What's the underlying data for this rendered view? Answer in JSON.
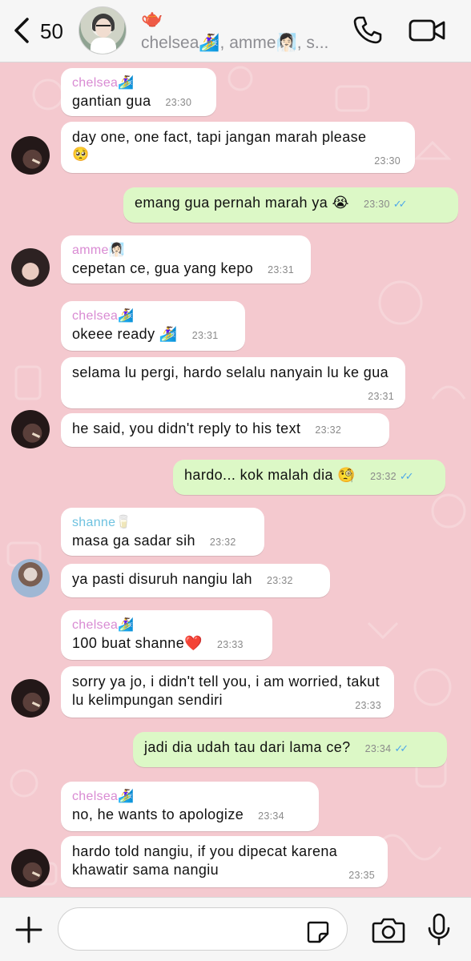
{
  "header": {
    "back_count": "50",
    "group_emoji": "🫖",
    "members": "chelsea🏄‍♀️, amme🧖🏻‍♀️, s...",
    "icons": {
      "back": "chevron-left-icon",
      "call": "phone-icon",
      "video": "video-camera-icon"
    }
  },
  "messages": [
    {
      "sender": "chelsea🏄‍♀️",
      "text": "gantian gua",
      "time": "23:30"
    },
    {
      "text": "day one, one fact, tapi jangan marah please",
      "emoji": "🥺",
      "time": "23:30"
    },
    {
      "text": "emang gua pernah marah ya 😭",
      "time": "23:30",
      "direction": "outgoing"
    },
    {
      "sender": "amme🧖🏻‍♀️",
      "text": "cepetan ce, gua yang kepo",
      "time": "23:31"
    },
    {
      "sender": "chelsea🏄‍♀️",
      "text": "okeee ready 🏄‍♀️",
      "time": "23:31"
    },
    {
      "text": "selama lu pergi, hardo selalu nanyain lu ke gua",
      "time": "23:31"
    },
    {
      "text": "he said, you didn't reply to his text",
      "time": "23:32"
    },
    {
      "text": "hardo... kok malah dia 🧐",
      "time": "23:32",
      "direction": "outgoing"
    },
    {
      "sender": "shanne🥛",
      "text": "masa ga sadar sih",
      "time": "23:32"
    },
    {
      "text": "ya pasti disuruh nangiu lah",
      "time": "23:32"
    },
    {
      "sender": "chelsea🏄‍♀️",
      "text": "100 buat shanne❤️",
      "time": "23:33"
    },
    {
      "text": "sorry ya jo, i didn't tell you, i am worried, takut lu kelimpungan sendiri",
      "time": "23:33"
    },
    {
      "text": "jadi dia udah tau dari lama ce?",
      "time": "23:34",
      "direction": "outgoing"
    },
    {
      "sender": "chelsea🏄‍♀️",
      "text": "no, he wants to apologize",
      "time": "23:34"
    },
    {
      "text": "hardo told nangiu, if you dipecat karena khawatir sama nangiu",
      "time": "23:35"
    }
  ],
  "read_ticks": "✓✓",
  "input": {
    "placeholder": "",
    "icons": {
      "add": "plus-icon",
      "sticker": "sticker-icon",
      "camera": "camera-icon",
      "mic": "microphone-icon"
    }
  },
  "colors": {
    "chat_background": "#f4c9cf",
    "outgoing_bubble": "#dcf8c6",
    "incoming_bubble": "#ffffff",
    "sender_pink": "#d98bd3",
    "sender_blue": "#6ec2e0",
    "read_tick": "#4fa8e8"
  }
}
